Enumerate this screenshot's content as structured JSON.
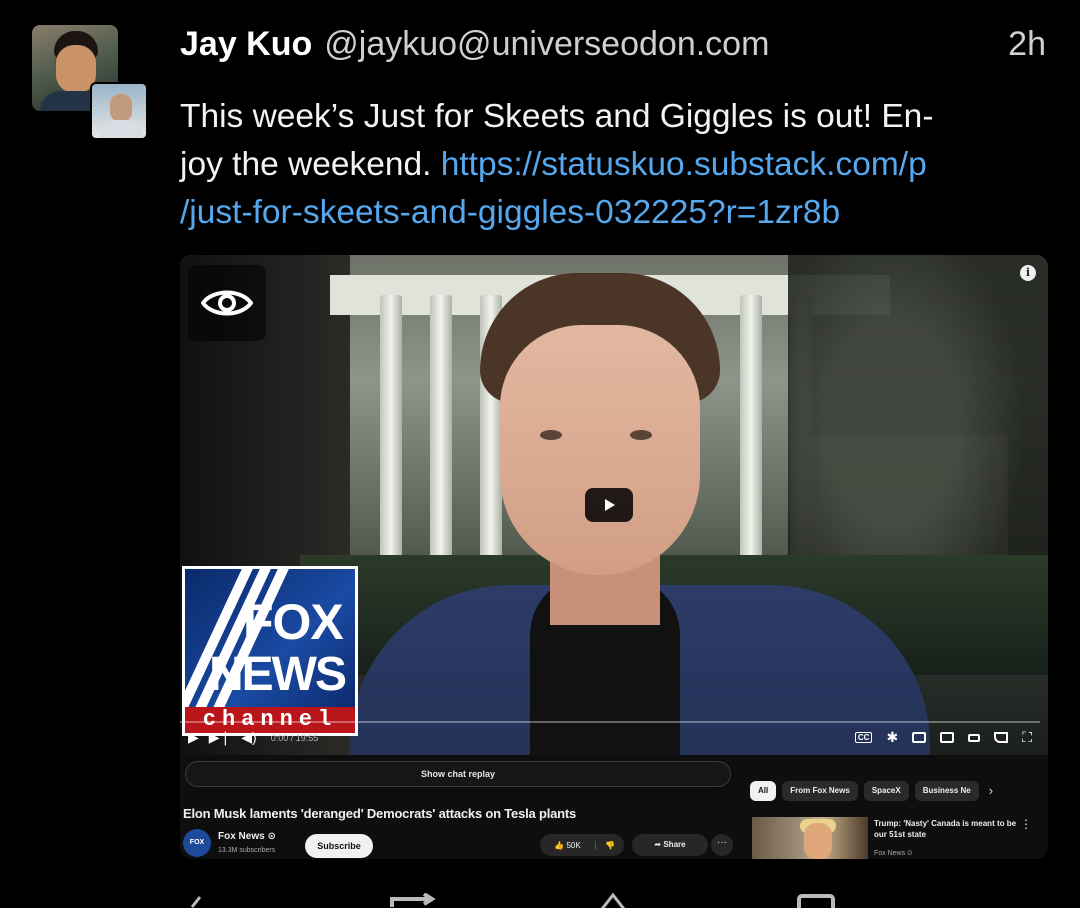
{
  "post": {
    "display_name": "Jay Kuo",
    "handle": "@jaykuo@universeodon.com",
    "time": "2h",
    "text": "This week’s Just for Skeets and Giggles is out! En-joy the weekend.",
    "text_line1": "This week’s Just for Skeets and Giggles is out! En-",
    "text_line2": "joy the weekend.",
    "link_line1": "https://statuskuo.substack.com/p",
    "link_line2": "/just-for-skeets-and-giggles-032225?r=1zr8b"
  },
  "media": {
    "alt_toggle_icon": "eye-icon",
    "info_icon": "info-icon",
    "fox_logo": {
      "line1": "FOX",
      "line2": "NEWS",
      "line3": "channel"
    },
    "player": {
      "time": "0:00 / 19:55",
      "cc_label": "CC"
    },
    "youtube": {
      "chat_replay": "Show chat replay",
      "video_title": "Elon Musk laments 'deranged' Democrats' attacks on Tesla plants",
      "channel_name": "Fox News ⊙",
      "subscribers": "13.3M subscribers",
      "subscribe": "Subscribe",
      "likes": "50K",
      "share": "Share",
      "more": "···",
      "chips": [
        "All",
        "From Fox News",
        "SpaceX",
        "Business Ne"
      ],
      "rec_title": "Trump: 'Nasty' Canada is meant to be our 51st state",
      "rec_channel": "Fox News ⊙",
      "rec_more": "⋮"
    }
  },
  "colors": {
    "background": "#000000",
    "link": "#56a8ee",
    "fox_red": "#b9151b",
    "fox_blue": "#1a4aa3"
  }
}
